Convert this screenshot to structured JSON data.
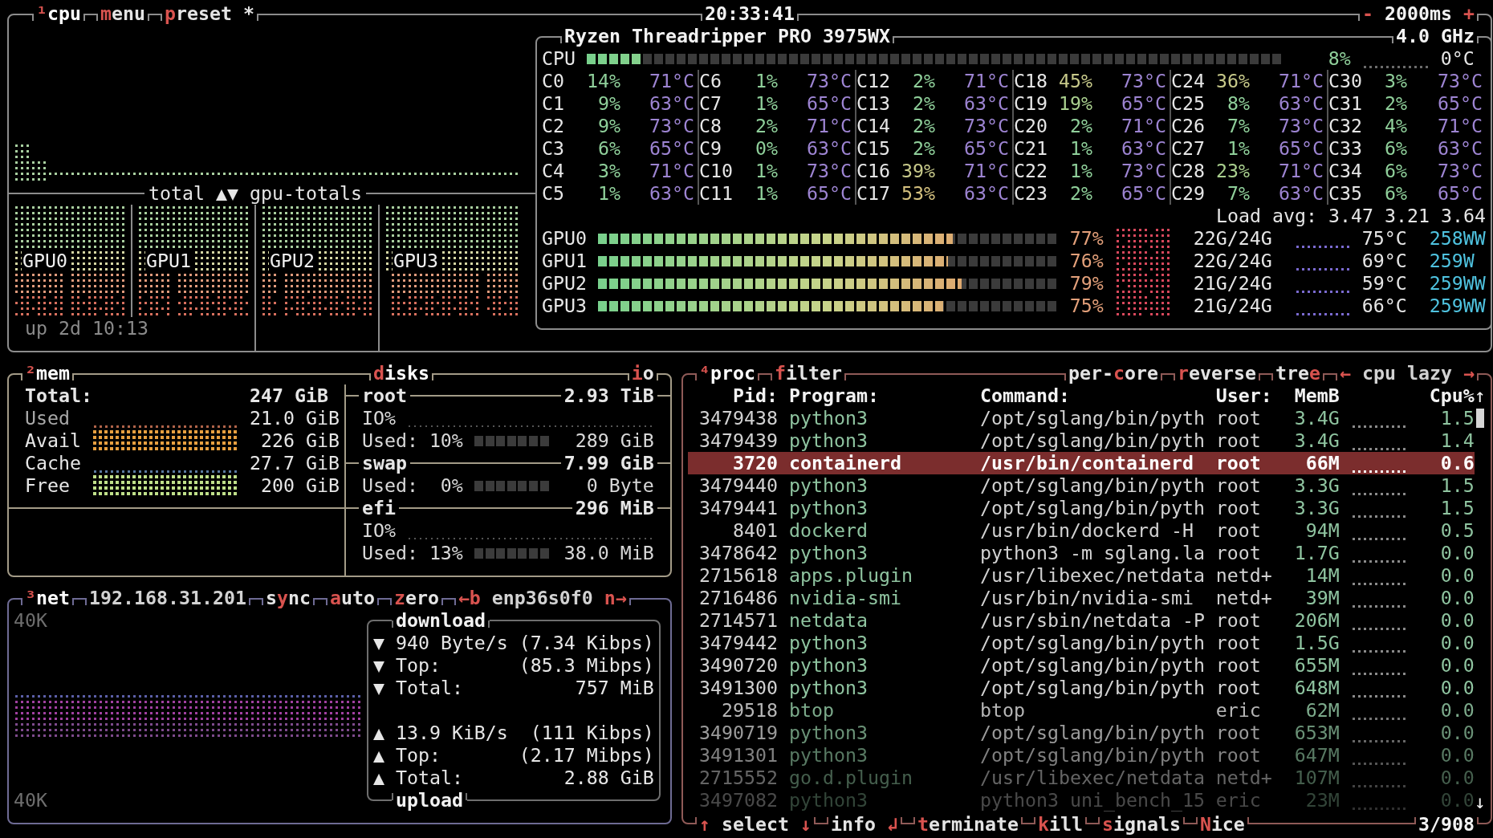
{
  "cpu_panel": {
    "tabs": [
      [
        {
          "kind": "title",
          "segments": [
            {
              "key": "¹"
            },
            {
              "text": "cpu"
            }
          ]
        }
      ],
      [
        {
          "kind": "option",
          "segments": [
            {
              "key": "m"
            },
            {
              "text": "enu"
            }
          ]
        }
      ],
      [
        {
          "kind": "option",
          "segments": [
            {
              "key": "p"
            },
            {
              "text": "reset *"
            }
          ]
        }
      ]
    ],
    "clock": "20:33:41",
    "interval": {
      "decrease": "-",
      "value": "2000ms",
      "increase": "+"
    },
    "graph_divider": {
      "left": "total",
      "toggle": "▲▼",
      "right": "gpu-totals"
    },
    "gpu_graphs": [
      {
        "label": "GPU0"
      },
      {
        "label": "GPU1"
      },
      {
        "label": "GPU2"
      },
      {
        "label": "GPU3"
      }
    ],
    "uptime": "up 2d 10:13",
    "info": {
      "model": "Ryzen Threadripper PRO 3975WX",
      "frequency": "4.0 GHz",
      "total": {
        "name": "CPU",
        "level": 0.08,
        "percent": "8%",
        "temp": "0°C"
      },
      "cores": [
        {
          "name": "C0",
          "percent": "14%",
          "temp": "71°C",
          "color": "#8fcf9a"
        },
        {
          "name": "C1",
          "percent": "9%",
          "temp": "63°C",
          "color": "#8fcf9a"
        },
        {
          "name": "C2",
          "percent": "9%",
          "temp": "73°C",
          "color": "#8fcf9a"
        },
        {
          "name": "C3",
          "percent": "6%",
          "temp": "65°C",
          "color": "#8fcf9a"
        },
        {
          "name": "C4",
          "percent": "3%",
          "temp": "71°C",
          "color": "#8fcf9a"
        },
        {
          "name": "C5",
          "percent": "1%",
          "temp": "63°C",
          "color": "#8fcf9a"
        },
        {
          "name": "C6",
          "percent": "1%",
          "temp": "73°C",
          "color": "#8fcf9a"
        },
        {
          "name": "C7",
          "percent": "1%",
          "temp": "65°C",
          "color": "#8fcf9a"
        },
        {
          "name": "C8",
          "percent": "2%",
          "temp": "71°C",
          "color": "#8fcf9a"
        },
        {
          "name": "C9",
          "percent": "0%",
          "temp": "63°C",
          "color": "#8fcf9a"
        },
        {
          "name": "C10",
          "percent": "1%",
          "temp": "73°C",
          "color": "#8fcf9a"
        },
        {
          "name": "C11",
          "percent": "1%",
          "temp": "65°C",
          "color": "#8fcf9a"
        },
        {
          "name": "C12",
          "percent": "2%",
          "temp": "71°C",
          "color": "#8fcf9a"
        },
        {
          "name": "C13",
          "percent": "2%",
          "temp": "63°C",
          "color": "#8fcf9a"
        },
        {
          "name": "C14",
          "percent": "2%",
          "temp": "73°C",
          "color": "#8fcf9a"
        },
        {
          "name": "C15",
          "percent": "2%",
          "temp": "65°C",
          "color": "#8fcf9a"
        },
        {
          "name": "C16",
          "percent": "39%",
          "temp": "71°C",
          "color": "#c7c98a"
        },
        {
          "name": "C17",
          "percent": "53%",
          "temp": "63°C",
          "color": "#d4c07e"
        },
        {
          "name": "C18",
          "percent": "45%",
          "temp": "73°C",
          "color": "#c7c98a"
        },
        {
          "name": "C19",
          "percent": "19%",
          "temp": "65°C",
          "color": "#a9cf8e"
        },
        {
          "name": "C20",
          "percent": "2%",
          "temp": "71°C",
          "color": "#8fcf9a"
        },
        {
          "name": "C21",
          "percent": "1%",
          "temp": "63°C",
          "color": "#8fcf9a"
        },
        {
          "name": "C22",
          "percent": "1%",
          "temp": "73°C",
          "color": "#8fcf9a"
        },
        {
          "name": "C23",
          "percent": "2%",
          "temp": "65°C",
          "color": "#8fcf9a"
        },
        {
          "name": "C24",
          "percent": "36%",
          "temp": "71°C",
          "color": "#c7c98a"
        },
        {
          "name": "C25",
          "percent": "8%",
          "temp": "63°C",
          "color": "#8fcf9a"
        },
        {
          "name": "C26",
          "percent": "7%",
          "temp": "73°C",
          "color": "#8fcf9a"
        },
        {
          "name": "C27",
          "percent": "1%",
          "temp": "65°C",
          "color": "#8fcf9a"
        },
        {
          "name": "C28",
          "percent": "23%",
          "temp": "71°C",
          "color": "#a9cf8e"
        },
        {
          "name": "C29",
          "percent": "7%",
          "temp": "63°C",
          "color": "#8fcf9a"
        },
        {
          "name": "C30",
          "percent": "3%",
          "temp": "73°C",
          "color": "#8fcf9a"
        },
        {
          "name": "C31",
          "percent": "2%",
          "temp": "65°C",
          "color": "#8fcf9a"
        },
        {
          "name": "C32",
          "percent": "4%",
          "temp": "71°C",
          "color": "#8fcf9a"
        },
        {
          "name": "C33",
          "percent": "6%",
          "temp": "63°C",
          "color": "#8fcf9a"
        },
        {
          "name": "C34",
          "percent": "6%",
          "temp": "73°C",
          "color": "#8fcf9a"
        },
        {
          "name": "C35",
          "percent": "6%",
          "temp": "65°C",
          "color": "#8fcf9a"
        }
      ],
      "load_avg": "Load avg: 3.47 3.21 3.64",
      "gpus": [
        {
          "name": "GPU0",
          "level": 0.77,
          "percent": "77%",
          "memory": "22G/24G",
          "temp": "75°C",
          "power": "258WW"
        },
        {
          "name": "GPU1",
          "level": 0.76,
          "percent": "76%",
          "memory": "22G/24G",
          "temp": "69°C",
          "power": "259W"
        },
        {
          "name": "GPU2",
          "level": 0.79,
          "percent": "79%",
          "memory": "21G/24G",
          "temp": "59°C",
          "power": "259WW"
        },
        {
          "name": "GPU3",
          "level": 0.75,
          "percent": "75%",
          "memory": "21G/24G",
          "temp": "66°C",
          "power": "259WW"
        }
      ]
    }
  },
  "mem_panel": {
    "tabs": [
      [
        {
          "kind": "title",
          "segments": [
            {
              "key": "²"
            },
            {
              "text": "mem"
            }
          ]
        }
      ]
    ],
    "total": {
      "label": "Total:",
      "value": "247 GiB"
    },
    "rows": [
      {
        "label": "Used",
        "value": "21.0 GiB",
        "color": "#b0644a"
      },
      {
        "label": "Avail",
        "value": "226 GiB",
        "color": "#e8a040"
      },
      {
        "label": "Cache",
        "value": "27.7 GiB",
        "color": "#5a7aa0"
      },
      {
        "label": "Free",
        "value": "200 GiB",
        "color": "#c0e08a"
      }
    ],
    "disks_tabs": [
      [
        {
          "kind": "title",
          "segments": [
            {
              "key": "d"
            },
            {
              "text": "isks"
            }
          ]
        }
      ]
    ],
    "io_tabs": [
      [
        {
          "kind": "option",
          "segments": [
            {
              "key": "i"
            },
            {
              "text": "o"
            }
          ]
        }
      ]
    ],
    "disks": [
      {
        "name": "root",
        "size": "2.93 TiB",
        "io_label": "IO%",
        "used_label": "Used:",
        "used_percent": "10%",
        "used": "289 GiB"
      },
      {
        "name": "swap",
        "size": "7.99 GiB",
        "used_label": "Used:",
        "used_percent": "0%",
        "used": "0 Byte"
      },
      {
        "name": "efi",
        "size": "296 MiB",
        "io_label": "IO%",
        "used_label": "Used:",
        "used_percent": "13%",
        "used": "38.0 MiB"
      }
    ]
  },
  "net_panel": {
    "tabs": [
      [
        {
          "kind": "title",
          "segments": [
            {
              "key": "³"
            },
            {
              "text": "net"
            }
          ]
        }
      ],
      [
        {
          "kind": "info",
          "segments": [
            {
              "text": "192.168.31.201"
            }
          ]
        }
      ],
      [
        {
          "kind": "option",
          "segments": [
            {
              "text": "s"
            },
            {
              "key": "y"
            },
            {
              "text": "nc"
            }
          ]
        }
      ],
      [
        {
          "kind": "option",
          "segments": [
            {
              "key": "a"
            },
            {
              "text": "uto"
            }
          ]
        }
      ],
      [
        {
          "kind": "option",
          "segments": [
            {
              "key": "z"
            },
            {
              "text": "ero"
            }
          ]
        }
      ],
      [
        {
          "kind": "option",
          "segments": [
            {
              "key": "←b"
            }
          ]
        },
        {
          "kind": "info",
          "segments": [
            {
              "text": "enp36s0f0"
            }
          ]
        },
        {
          "kind": "option",
          "segments": [
            {
              "key": "n→"
            }
          ]
        }
      ]
    ],
    "scale_top": "40K",
    "scale_bottom": "40K",
    "download": {
      "title": "download",
      "rows": [
        {
          "arrow": "▼",
          "label": "940 Byte/s",
          "value": "(7.34 Kibps)"
        },
        {
          "arrow": "▼",
          "label": "Top:",
          "value": "(85.3 Mibps)"
        },
        {
          "arrow": "▼",
          "label": "Total:",
          "value": "757 MiB"
        }
      ]
    },
    "upload": {
      "title": "upload",
      "rows": [
        {
          "arrow": "▲",
          "label": "13.9 KiB/s",
          "value": "(111 Kibps)"
        },
        {
          "arrow": "▲",
          "label": "Top:",
          "value": "(2.17 Mibps)"
        },
        {
          "arrow": "▲",
          "label": "Total:",
          "value": "2.88 GiB"
        }
      ]
    }
  },
  "proc_panel": {
    "tabs_left": [
      [
        {
          "kind": "title",
          "segments": [
            {
              "key": "⁴"
            },
            {
              "text": "proc"
            }
          ]
        }
      ],
      [
        {
          "kind": "option",
          "segments": [
            {
              "key": "f"
            },
            {
              "text": "ilter"
            }
          ]
        }
      ]
    ],
    "tabs_right": [
      [
        {
          "kind": "option",
          "segments": [
            {
              "text": "per-"
            },
            {
              "key": "c"
            },
            {
              "text": "ore"
            }
          ]
        }
      ],
      [
        {
          "kind": "option",
          "segments": [
            {
              "key": "r"
            },
            {
              "text": "everse"
            }
          ]
        }
      ],
      [
        {
          "kind": "option",
          "segments": [
            {
              "text": "tre"
            },
            {
              "key": "e"
            }
          ]
        }
      ],
      [
        {
          "kind": "option",
          "segments": [
            {
              "key": "←"
            }
          ]
        },
        {
          "kind": "info",
          "segments": [
            {
              "text": "cpu lazy"
            }
          ]
        },
        {
          "kind": "option",
          "segments": [
            {
              "key": "→"
            }
          ]
        }
      ]
    ],
    "columns": [
      "Pid:",
      "Program:",
      "Command:",
      "User:",
      "MemB",
      "Cpu%"
    ],
    "scroll_up": "↑",
    "scroll_down": "↓",
    "rows": [
      {
        "pid": "3479438",
        "program": "python3",
        "command": "/opt/sglang/bin/pyth",
        "user": "root",
        "mem": "3.4G",
        "cpu": "1.5",
        "selected": false
      },
      {
        "pid": "3479439",
        "program": "python3",
        "command": "/opt/sglang/bin/pyth",
        "user": "root",
        "mem": "3.4G",
        "cpu": "1.4",
        "selected": false
      },
      {
        "pid": "3720",
        "program": "containerd",
        "command": "/usr/bin/containerd",
        "user": "root",
        "mem": "66M",
        "cpu": "0.6",
        "selected": true
      },
      {
        "pid": "3479440",
        "program": "python3",
        "command": "/opt/sglang/bin/pyth",
        "user": "root",
        "mem": "3.3G",
        "cpu": "1.5",
        "selected": false
      },
      {
        "pid": "3479441",
        "program": "python3",
        "command": "/opt/sglang/bin/pyth",
        "user": "root",
        "mem": "3.3G",
        "cpu": "1.5",
        "selected": false
      },
      {
        "pid": "8401",
        "program": "dockerd",
        "command": "/usr/bin/dockerd -H",
        "user": "root",
        "mem": "94M",
        "cpu": "0.5",
        "selected": false
      },
      {
        "pid": "3478642",
        "program": "python3",
        "command": "python3 -m sglang.la",
        "user": "root",
        "mem": "1.7G",
        "cpu": "0.0",
        "selected": false
      },
      {
        "pid": "2715618",
        "program": "apps.plugin",
        "command": "/usr/libexec/netdata",
        "user": "netd+",
        "mem": "14M",
        "cpu": "0.0",
        "selected": false
      },
      {
        "pid": "2716486",
        "program": "nvidia-smi",
        "command": "/usr/bin/nvidia-smi",
        "user": "netd+",
        "mem": "39M",
        "cpu": "0.0",
        "selected": false
      },
      {
        "pid": "2714571",
        "program": "netdata",
        "command": "/usr/sbin/netdata -P",
        "user": "root",
        "mem": "206M",
        "cpu": "0.0",
        "selected": false
      },
      {
        "pid": "3479442",
        "program": "python3",
        "command": "/opt/sglang/bin/pyth",
        "user": "root",
        "mem": "1.5G",
        "cpu": "0.0",
        "selected": false
      },
      {
        "pid": "3490720",
        "program": "python3",
        "command": "/opt/sglang/bin/pyth",
        "user": "root",
        "mem": "655M",
        "cpu": "0.0",
        "selected": false
      },
      {
        "pid": "3491300",
        "program": "python3",
        "command": "/opt/sglang/bin/pyth",
        "user": "root",
        "mem": "648M",
        "cpu": "0.0",
        "selected": false
      },
      {
        "pid": "29518",
        "program": "btop",
        "command": "btop",
        "user": "eric",
        "mem": "62M",
        "cpu": "0.0",
        "selected": false
      },
      {
        "pid": "3490719",
        "program": "python3",
        "command": "/opt/sglang/bin/pyth",
        "user": "root",
        "mem": "653M",
        "cpu": "0.0",
        "selected": false
      },
      {
        "pid": "3491301",
        "program": "python3",
        "command": "/opt/sglang/bin/pyth",
        "user": "root",
        "mem": "647M",
        "cpu": "0.0",
        "selected": false
      },
      {
        "pid": "2715552",
        "program": "go.d.plugin",
        "command": "/usr/libexec/netdata",
        "user": "netd+",
        "mem": "107M",
        "cpu": "0.0",
        "selected": false
      },
      {
        "pid": "3497082",
        "program": "python3",
        "command": "python3 uni_bench_15",
        "user": "eric",
        "mem": "23M",
        "cpu": "0.0",
        "selected": false
      }
    ],
    "footer": [
      [
        {
          "kind": "option",
          "segments": [
            {
              "key": "↑"
            },
            {
              "text": " select "
            },
            {
              "key": "↓"
            }
          ]
        }
      ],
      [
        {
          "kind": "option",
          "segments": [
            {
              "text": "info "
            },
            {
              "key": "↲"
            }
          ]
        }
      ],
      [
        {
          "kind": "option",
          "segments": [
            {
              "key": "t"
            },
            {
              "text": "erminate"
            }
          ]
        }
      ],
      [
        {
          "kind": "option",
          "segments": [
            {
              "key": "k"
            },
            {
              "text": "ill"
            }
          ]
        }
      ],
      [
        {
          "kind": "option",
          "segments": [
            {
              "key": "s"
            },
            {
              "text": "ignals"
            }
          ]
        }
      ],
      [
        {
          "kind": "option",
          "segments": [
            {
              "key": "N"
            },
            {
              "text": "ice"
            }
          ]
        }
      ]
    ],
    "count": "3/908"
  }
}
